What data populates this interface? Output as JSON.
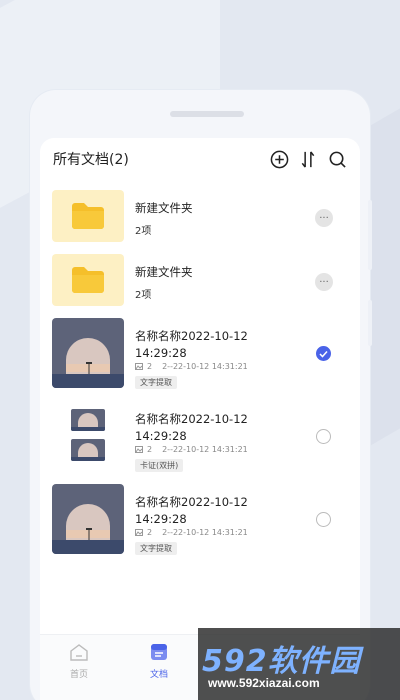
{
  "header": {
    "title": "所有文档(2)",
    "icons": [
      "add-icon",
      "sort-icon",
      "search-icon"
    ]
  },
  "items": [
    {
      "type": "folder",
      "title": "新建文件夹",
      "subtitle": "2项",
      "action": "more"
    },
    {
      "type": "folder",
      "title": "新建文件夹",
      "subtitle": "2项",
      "action": "more"
    },
    {
      "type": "document",
      "title": "名称名称2022-10-12 14:29:28",
      "pages": "2",
      "time": "2--22-10-12  14:31:21",
      "tag": "文字提取",
      "selected": true
    },
    {
      "type": "document",
      "title": "名称名称2022-10-12 14:29:28",
      "pages": "2",
      "time": "2--22-10-12  14:31:21",
      "tag": "卡证(双拼)",
      "selected": false
    },
    {
      "type": "document",
      "title": "名称名称2022-10-12 14:29:28",
      "pages": "2",
      "time": "2--22-10-12  14:31:21",
      "tag": "文字提取",
      "selected": false
    }
  ],
  "more_glyph": "···",
  "tabbar": {
    "tabs": [
      {
        "label": "首页",
        "icon": "home-icon",
        "active": false
      },
      {
        "label": "文档",
        "icon": "document-icon",
        "active": true
      }
    ]
  },
  "watermark": {
    "logo": "592软件园",
    "url": "www.592xiazai.com"
  },
  "colors": {
    "accent": "#4a63e8",
    "folder_bg": "#fdf0c4",
    "folder_icon": "#f5bf2a",
    "background": "#e3e8f1"
  }
}
